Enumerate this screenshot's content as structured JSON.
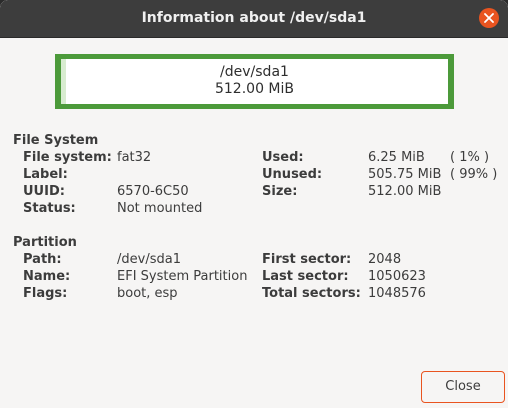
{
  "window": {
    "title": "Information about /dev/sda1"
  },
  "usage_bar": {
    "path": "/dev/sda1",
    "size": "512.00 MiB",
    "used_fraction": 0.012,
    "color": "#4c9a3a"
  },
  "file_system": {
    "heading": "File System",
    "fs_label": "File system:",
    "fs_value": "fat32",
    "label_label": "Label:",
    "label_value": "",
    "uuid_label": "UUID:",
    "uuid_value": "6570-6C50",
    "status_label": "Status:",
    "status_value": "Not mounted",
    "used_label": "Used:",
    "used_value": "6.25 MiB",
    "used_pct": "( 1% )",
    "unused_label": "Unused:",
    "unused_value": "505.75 MiB",
    "unused_pct": "( 99% )",
    "size_label": "Size:",
    "size_value": "512.00 MiB"
  },
  "partition": {
    "heading": "Partition",
    "path_label": "Path:",
    "path_value": "/dev/sda1",
    "name_label": "Name:",
    "name_value": "EFI System Partition",
    "flags_label": "Flags:",
    "flags_value": "boot, esp",
    "first_label": "First sector:",
    "first_value": "2048",
    "last_label": "Last sector:",
    "last_value": "1050623",
    "total_label": "Total sectors:",
    "total_value": "1048576"
  },
  "buttons": {
    "close_label": "Close"
  },
  "colors": {
    "accent": "#e95420",
    "titlebar": "#3d3d3d"
  }
}
